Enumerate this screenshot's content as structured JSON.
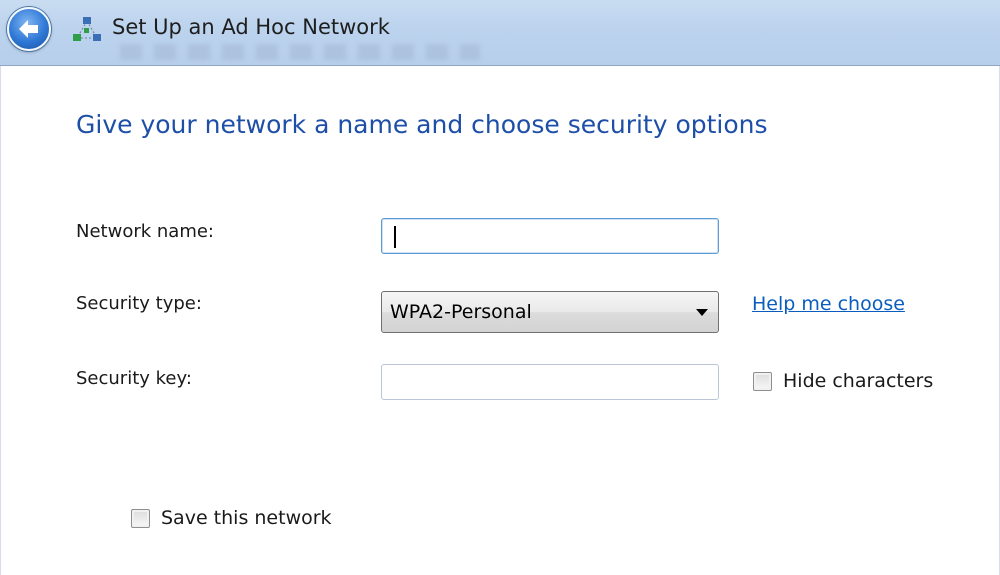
{
  "window": {
    "title": "Set Up an Ad Hoc Network"
  },
  "page": {
    "heading": "Give your network a name and choose security options"
  },
  "form": {
    "network_name": {
      "label": "Network name:",
      "value": ""
    },
    "security_type": {
      "label": "Security type:",
      "selected": "WPA2-Personal",
      "help_link": "Help me choose"
    },
    "security_key": {
      "label": "Security key:",
      "value": "",
      "hide_characters_label": "Hide characters",
      "hide_characters_checked": false
    },
    "save_network": {
      "label": "Save this network",
      "checked": false
    }
  },
  "icons": {
    "back": "back-arrow-icon",
    "network": "ad-hoc-network-icon",
    "dropdown": "chevron-down-icon"
  },
  "colors": {
    "heading": "#1e4fa8",
    "link": "#0b5dbd",
    "titlebar": "#bcd3ee"
  }
}
